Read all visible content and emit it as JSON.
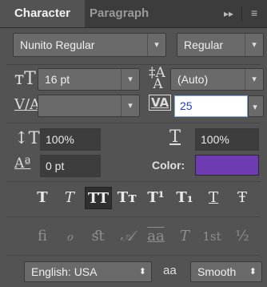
{
  "tabs": {
    "character": "Character",
    "paragraph": "Paragraph"
  },
  "panel_controls": {
    "collapse": "▸▸",
    "menu": "≡"
  },
  "font": {
    "family": "Nunito Regular",
    "style": "Regular"
  },
  "metrics": {
    "font_size": "16 pt",
    "leading": "(Auto)",
    "kerning": "",
    "tracking": "25",
    "vertical_scale": "100%",
    "horizontal_scale": "100%",
    "baseline_shift": "0 pt"
  },
  "color": {
    "label": "Color:",
    "value": "#6f3bb3"
  },
  "type_buttons": [
    "T",
    "T",
    "TT",
    "Tт",
    "T¹",
    "T₁",
    "T",
    "Ŧ"
  ],
  "opentype_buttons": [
    "ﬁ",
    "ℴ",
    "ﬆ",
    "𝒜",
    "aa",
    "T",
    "1st",
    "½"
  ],
  "language": {
    "value": "English: USA",
    "aa_label": "aa",
    "antialias": "Smooth"
  }
}
